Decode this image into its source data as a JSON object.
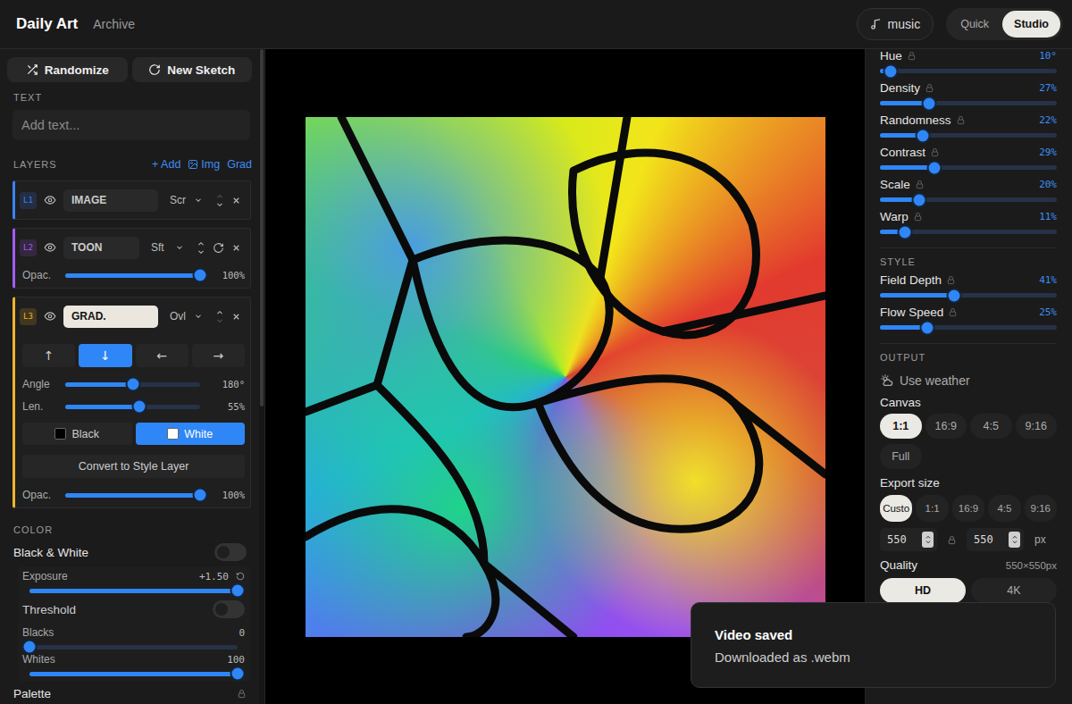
{
  "header": {
    "logo": "Daily Art",
    "nav": "Archive",
    "music": "music",
    "modes": [
      {
        "label": "Quick",
        "selected": false
      },
      {
        "label": "Studio",
        "selected": true
      }
    ]
  },
  "left": {
    "actions": [
      "Randomize",
      "New Sketch"
    ],
    "text": {
      "title": "TEXT",
      "placeholder": "Add text..."
    },
    "layers": {
      "title": "LAYERS",
      "actions": [
        "+ Add",
        "Img",
        "Grad"
      ],
      "items": [
        {
          "badge": "L1",
          "name": "IMAGE",
          "blend": "Scr",
          "color": "#3b82f6",
          "visible": true,
          "selected": false,
          "up_disabled": true,
          "down_disabled": false,
          "regenerate": false,
          "controls": []
        },
        {
          "badge": "L2",
          "name": "TOON",
          "blend": "Sft",
          "color": "#a25cf2",
          "visible": true,
          "selected": false,
          "up_disabled": false,
          "down_disabled": false,
          "regenerate": true,
          "controls": [
            {
              "kind": "slider",
              "label": "Opac.",
              "level": 1,
              "reading": "100%"
            }
          ]
        },
        {
          "badge": "L3",
          "name": "GRAD.",
          "blend": "Ovl",
          "color": "#f0b429",
          "visible": true,
          "selected": true,
          "up_disabled": false,
          "down_disabled": true,
          "regenerate": false,
          "controls": [
            {
              "kind": "directions",
              "options": [
                {
                  "label": "↑",
                  "selected": false
                },
                {
                  "label": "↓",
                  "selected": true
                },
                {
                  "label": "←",
                  "selected": false
                },
                {
                  "label": "→",
                  "selected": false
                }
              ]
            },
            {
              "kind": "slider",
              "label": "Angle",
              "level": 0.5,
              "reading": "180°"
            },
            {
              "kind": "slider",
              "label": "Len.",
              "level": 0.55,
              "reading": "55%"
            },
            {
              "kind": "swatches",
              "options": [
                {
                  "label": "Black",
                  "selected": false,
                  "color": "#000000"
                },
                {
                  "label": "White",
                  "selected": true,
                  "color": "#ffffff"
                }
              ]
            },
            {
              "kind": "button",
              "label": "Convert to Style Layer"
            },
            {
              "kind": "slider",
              "label": "Opac.",
              "level": 1,
              "reading": "100%"
            }
          ]
        }
      ]
    },
    "color": {
      "title": "COLOR",
      "bw": {
        "label": "Black & White",
        "on": false
      },
      "settings": [
        {
          "kind": "slider",
          "label": "Exposure",
          "reading": "+1.50",
          "level": 1,
          "resettable": true
        },
        {
          "kind": "toggle",
          "label": "Threshold",
          "on": false
        },
        {
          "kind": "slider",
          "label": "Blacks",
          "reading": "0",
          "level": 0,
          "resettable": false
        },
        {
          "kind": "slider",
          "label": "Whites",
          "reading": "100",
          "level": 1,
          "resettable": false
        }
      ],
      "palette": {
        "label": "Palette"
      }
    }
  },
  "right": {
    "sliders": [
      {
        "label": "Hue",
        "reading": "10°",
        "level": 0.06
      },
      {
        "label": "Density",
        "reading": "27%",
        "level": 0.28
      },
      {
        "label": "Randomness",
        "reading": "22%",
        "level": 0.24
      },
      {
        "label": "Contrast",
        "reading": "29%",
        "level": 0.31
      },
      {
        "label": "Scale",
        "reading": "20%",
        "level": 0.22
      },
      {
        "label": "Warp",
        "reading": "11%",
        "level": 0.14
      }
    ],
    "style": {
      "title": "STYLE",
      "sliders": [
        {
          "label": "Field Depth",
          "reading": "41%",
          "level": 0.42
        },
        {
          "label": "Flow Speed",
          "reading": "25%",
          "level": 0.27
        }
      ]
    },
    "output": {
      "title": "OUTPUT",
      "weather": "Use weather",
      "canvas": {
        "label": "Canvas",
        "options": [
          {
            "label": "1:1",
            "selected": true
          },
          {
            "label": "16:9",
            "selected": false
          },
          {
            "label": "4:5",
            "selected": false
          },
          {
            "label": "9:16",
            "selected": false
          },
          {
            "label": "Full",
            "selected": false
          }
        ]
      },
      "export": {
        "label": "Export size",
        "options": [
          {
            "label": "Custo",
            "selected": true
          },
          {
            "label": "1:1",
            "selected": false
          },
          {
            "label": "16:9",
            "selected": false
          },
          {
            "label": "4:5",
            "selected": false
          },
          {
            "label": "9:16",
            "selected": false
          }
        ],
        "width": "550",
        "height": "550",
        "unit": "px"
      },
      "quality": {
        "label": "Quality",
        "size": "550×550px",
        "options": [
          {
            "label": "HD",
            "selected": true
          },
          {
            "label": "4K",
            "selected": false
          }
        ]
      }
    }
  },
  "toast": {
    "title": "Video saved",
    "message": "Downloaded as .webm"
  }
}
